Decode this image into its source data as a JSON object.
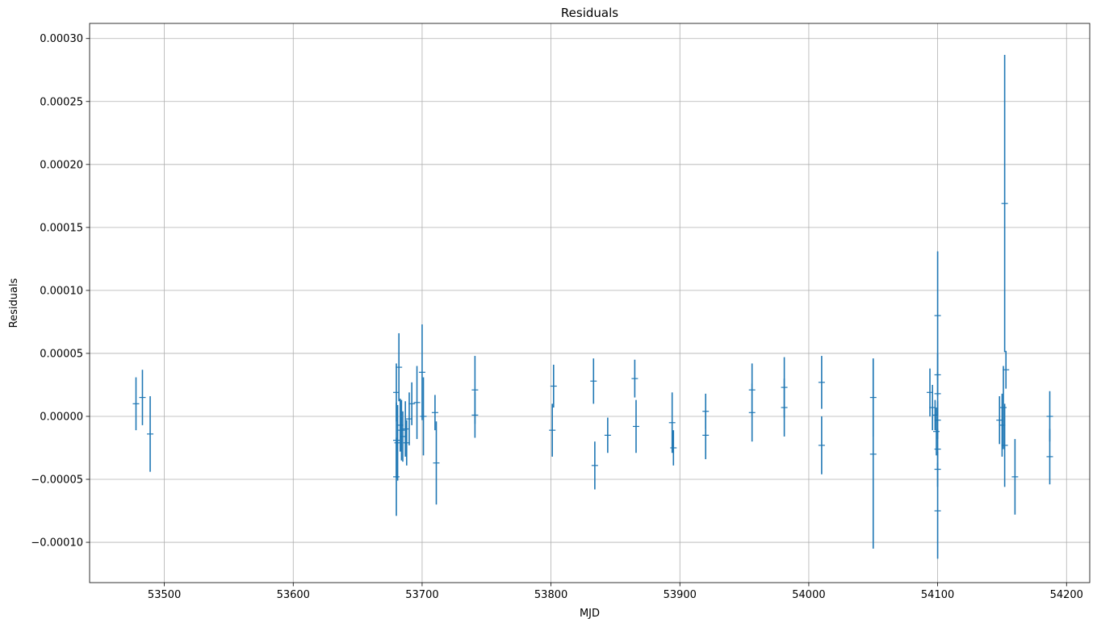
{
  "chart_data": {
    "type": "scatter",
    "style": "errorbar",
    "title": "Residuals",
    "xlabel": "MJD",
    "ylabel": "Residuals",
    "xlim": [
      53442,
      54218
    ],
    "ylim": [
      -0.000132,
      0.000312
    ],
    "xticks": [
      53500,
      53600,
      53700,
      53800,
      53900,
      54000,
      54100,
      54200
    ],
    "yticks": [
      -0.0001,
      -5e-05,
      0.0,
      5e-05,
      0.0001,
      0.00015,
      0.0002,
      0.00025,
      0.0003
    ],
    "ytick_labels": [
      "−0.00010",
      "−0.00005",
      "0.00000",
      "0.00005",
      "0.00010",
      "0.00015",
      "0.00020",
      "0.00025",
      "0.00030"
    ],
    "grid": true,
    "color": "#1f77b4",
    "points": [
      {
        "x": 53478,
        "y": 1e-05,
        "err": 2.1e-05
      },
      {
        "x": 53483,
        "y": 1.5e-05,
        "err": 2.2e-05
      },
      {
        "x": 53489,
        "y": -1.4e-05,
        "err": 3e-05
      },
      {
        "x": 53680,
        "y": -1.9e-05,
        "err": 3e-05
      },
      {
        "x": 53680,
        "y": -4.8e-05,
        "err": 3.1e-05
      },
      {
        "x": 53680,
        "y": 1.9e-05,
        "err": 2.3e-05
      },
      {
        "x": 53681,
        "y": -2.1e-05,
        "err": 3e-05
      },
      {
        "x": 53682,
        "y": 3.9e-05,
        "err": 2.7e-05
      },
      {
        "x": 53683,
        "y": -7e-06,
        "err": 2.1e-05
      },
      {
        "x": 53684,
        "y": -1.1e-05,
        "err": 2.4e-05
      },
      {
        "x": 53685,
        "y": -1.6e-05,
        "err": 2e-05
      },
      {
        "x": 53687,
        "y": -1e-05,
        "err": 2.2e-05
      },
      {
        "x": 53688,
        "y": -2.1e-05,
        "err": 1.8e-05
      },
      {
        "x": 53690,
        "y": -2e-06,
        "err": 2.1e-05
      },
      {
        "x": 53692,
        "y": 1e-05,
        "err": 1.7e-05
      },
      {
        "x": 53696,
        "y": 1.1e-05,
        "err": 2.9e-05
      },
      {
        "x": 53700,
        "y": 3.5e-05,
        "err": 3.8e-05
      },
      {
        "x": 53701,
        "y": 0.0,
        "err": 3.1e-05
      },
      {
        "x": 53710,
        "y": 3e-06,
        "err": 1.4e-05
      },
      {
        "x": 53711,
        "y": -3.7e-05,
        "err": 3.3e-05
      },
      {
        "x": 53741,
        "y": 2.1e-05,
        "err": 2.7e-05
      },
      {
        "x": 53741,
        "y": 1e-06,
        "err": 1.8e-05
      },
      {
        "x": 53801,
        "y": -1.1e-05,
        "err": 2.1e-05
      },
      {
        "x": 53802,
        "y": 2.4e-05,
        "err": 1.7e-05
      },
      {
        "x": 53833,
        "y": 2.8e-05,
        "err": 1.8e-05
      },
      {
        "x": 53834,
        "y": -3.9e-05,
        "err": 1.9e-05
      },
      {
        "x": 53844,
        "y": -1.5e-05,
        "err": 1.4e-05
      },
      {
        "x": 53865,
        "y": 3e-05,
        "err": 1.5e-05
      },
      {
        "x": 53866,
        "y": -8e-06,
        "err": 2.1e-05
      },
      {
        "x": 53894,
        "y": -5e-06,
        "err": 2.4e-05
      },
      {
        "x": 53895,
        "y": -2.5e-05,
        "err": 1.4e-05
      },
      {
        "x": 53920,
        "y": 4e-06,
        "err": 1.4e-05
      },
      {
        "x": 53920,
        "y": -1.5e-05,
        "err": 1.9e-05
      },
      {
        "x": 53956,
        "y": 2.1e-05,
        "err": 2.1e-05
      },
      {
        "x": 53956,
        "y": 3e-06,
        "err": 2.3e-05
      },
      {
        "x": 53981,
        "y": 2.3e-05,
        "err": 2.4e-05
      },
      {
        "x": 53981,
        "y": 7e-06,
        "err": 2.3e-05
      },
      {
        "x": 54010,
        "y": 2.7e-05,
        "err": 2.1e-05
      },
      {
        "x": 54010,
        "y": -2.3e-05,
        "err": 2.3e-05
      },
      {
        "x": 54050,
        "y": 1.5e-05,
        "err": 3.1e-05
      },
      {
        "x": 54050,
        "y": -3e-05,
        "err": 7.5e-05
      },
      {
        "x": 54094,
        "y": 1.9e-05,
        "err": 1.9e-05
      },
      {
        "x": 54096,
        "y": 7e-06,
        "err": 1.8e-05
      },
      {
        "x": 54098,
        "y": 1e-06,
        "err": 1.2e-05
      },
      {
        "x": 54099,
        "y": -1.2e-05,
        "err": 1.9e-05
      },
      {
        "x": 54100,
        "y": 8e-05,
        "err": 5.1e-05
      },
      {
        "x": 54100,
        "y": 3.3e-05,
        "err": 1.7e-05
      },
      {
        "x": 54100,
        "y": 1.8e-05,
        "err": 1.7e-05
      },
      {
        "x": 54100,
        "y": -3e-06,
        "err": 1.5e-05
      },
      {
        "x": 54100,
        "y": -2.6e-05,
        "err": 1.6e-05
      },
      {
        "x": 54100,
        "y": -4.2e-05,
        "err": 1.4e-05
      },
      {
        "x": 54100,
        "y": -7.5e-05,
        "err": 3.8e-05
      },
      {
        "x": 54148,
        "y": -3e-06,
        "err": 1.9e-05
      },
      {
        "x": 54150,
        "y": -7e-06,
        "err": 2.5e-05
      },
      {
        "x": 54151,
        "y": 7e-06,
        "err": 3.3e-05
      },
      {
        "x": 54152,
        "y": -2.3e-05,
        "err": 3.3e-05
      },
      {
        "x": 54152,
        "y": 0.000169,
        "err": 0.000118
      },
      {
        "x": 54153,
        "y": 3.7e-05,
        "err": 1.5e-05
      },
      {
        "x": 54160,
        "y": -4.8e-05,
        "err": 3e-05
      },
      {
        "x": 54187,
        "y": 0.0,
        "err": 2e-05
      },
      {
        "x": 54187,
        "y": -3.2e-05,
        "err": 2.2e-05
      }
    ]
  }
}
